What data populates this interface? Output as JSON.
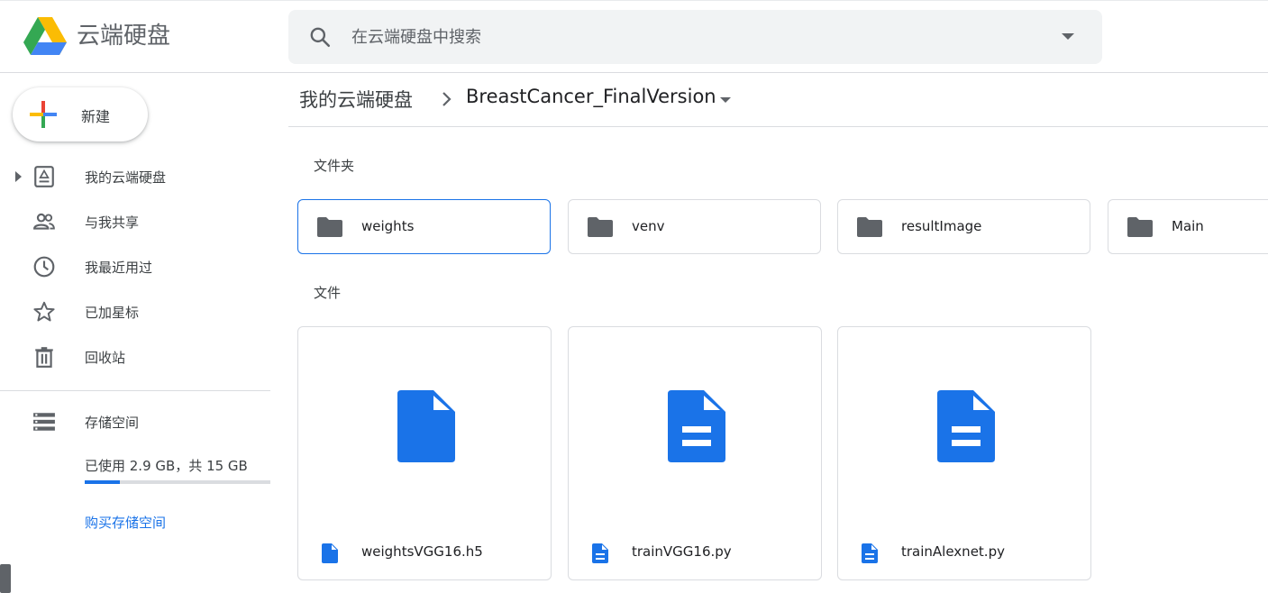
{
  "header": {
    "app_title": "云端硬盘",
    "search_placeholder": "在云端硬盘中搜索"
  },
  "sidebar": {
    "new_label": "新建",
    "items": [
      {
        "label": "我的云端硬盘",
        "icon": "drive-icon"
      },
      {
        "label": "与我共享",
        "icon": "people-icon"
      },
      {
        "label": "我最近用过",
        "icon": "clock-icon"
      },
      {
        "label": "已加星标",
        "icon": "star-icon"
      },
      {
        "label": "回收站",
        "icon": "trash-icon"
      }
    ],
    "storage": {
      "label": "存储空间",
      "usage_text": "已使用 2.9 GB，共 15 GB",
      "used_fraction": 0.19,
      "buy_label": "购买存储空间"
    }
  },
  "breadcrumb": {
    "root": "我的云端硬盘",
    "current": "BreastCancer_FinalVersion"
  },
  "main": {
    "folders_title": "文件夹",
    "files_title": "文件",
    "folders": [
      {
        "name": "weights"
      },
      {
        "name": "venv"
      },
      {
        "name": "resultImage"
      },
      {
        "name": "Main"
      }
    ],
    "files": [
      {
        "name": "weightsVGG16.h5",
        "icon": "file-icon"
      },
      {
        "name": "trainVGG16.py",
        "icon": "document-icon"
      },
      {
        "name": "trainAlexnet.py",
        "icon": "document-icon"
      }
    ]
  },
  "colors": {
    "accent": "#1a73e8",
    "icon_gray": "#5f6368",
    "border": "#dadce0"
  }
}
